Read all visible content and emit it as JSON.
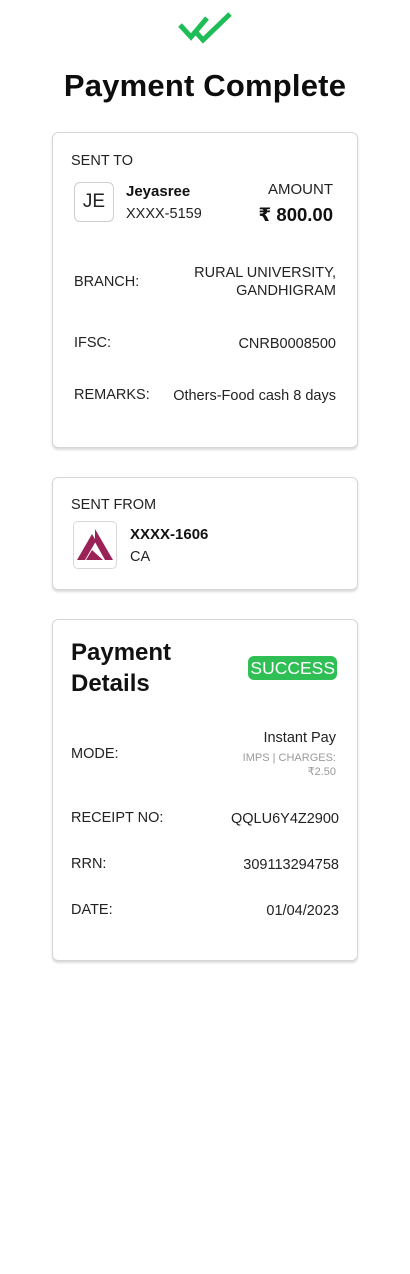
{
  "header": {
    "title": "Payment Complete",
    "icon": "double-check-icon",
    "icon_color": "#1fbd57"
  },
  "sent_to": {
    "label": "SENT TO",
    "avatar_initials": "JE",
    "name": "Jeyasree",
    "account": "XXXX-5159",
    "amount_label": "AMOUNT",
    "amount": "₹ 800.00",
    "rows": [
      {
        "label": "BRANCH:",
        "value_lines": [
          "RURAL UNIVERSITY,",
          "GANDHIGRAM"
        ]
      },
      {
        "label": "IFSC:",
        "value": "CNRB0008500"
      },
      {
        "label": "REMARKS:",
        "value": "Others-Food cash 8 days"
      }
    ]
  },
  "sent_from": {
    "label": "SENT FROM",
    "bank_logo": "axis-bank-logo",
    "logo_color": "#9b2257",
    "account": "XXXX-1606",
    "account_type": "CA"
  },
  "payment_details": {
    "title_lines": [
      "Payment",
      "Details"
    ],
    "status": "SUCCESS",
    "status_color": "#2fbf55",
    "mode_label": "MODE:",
    "mode_value": "Instant Pay",
    "mode_sub_lines": [
      "IMPS | CHARGES:",
      "₹2.50"
    ],
    "receipt_label": "RECEIPT NO:",
    "receipt_value": "QQLU6Y4Z2900",
    "rrn_label": "RRN:",
    "rrn_value": "309113294758",
    "date_label": "DATE:",
    "date_value": "01/04/2023"
  }
}
